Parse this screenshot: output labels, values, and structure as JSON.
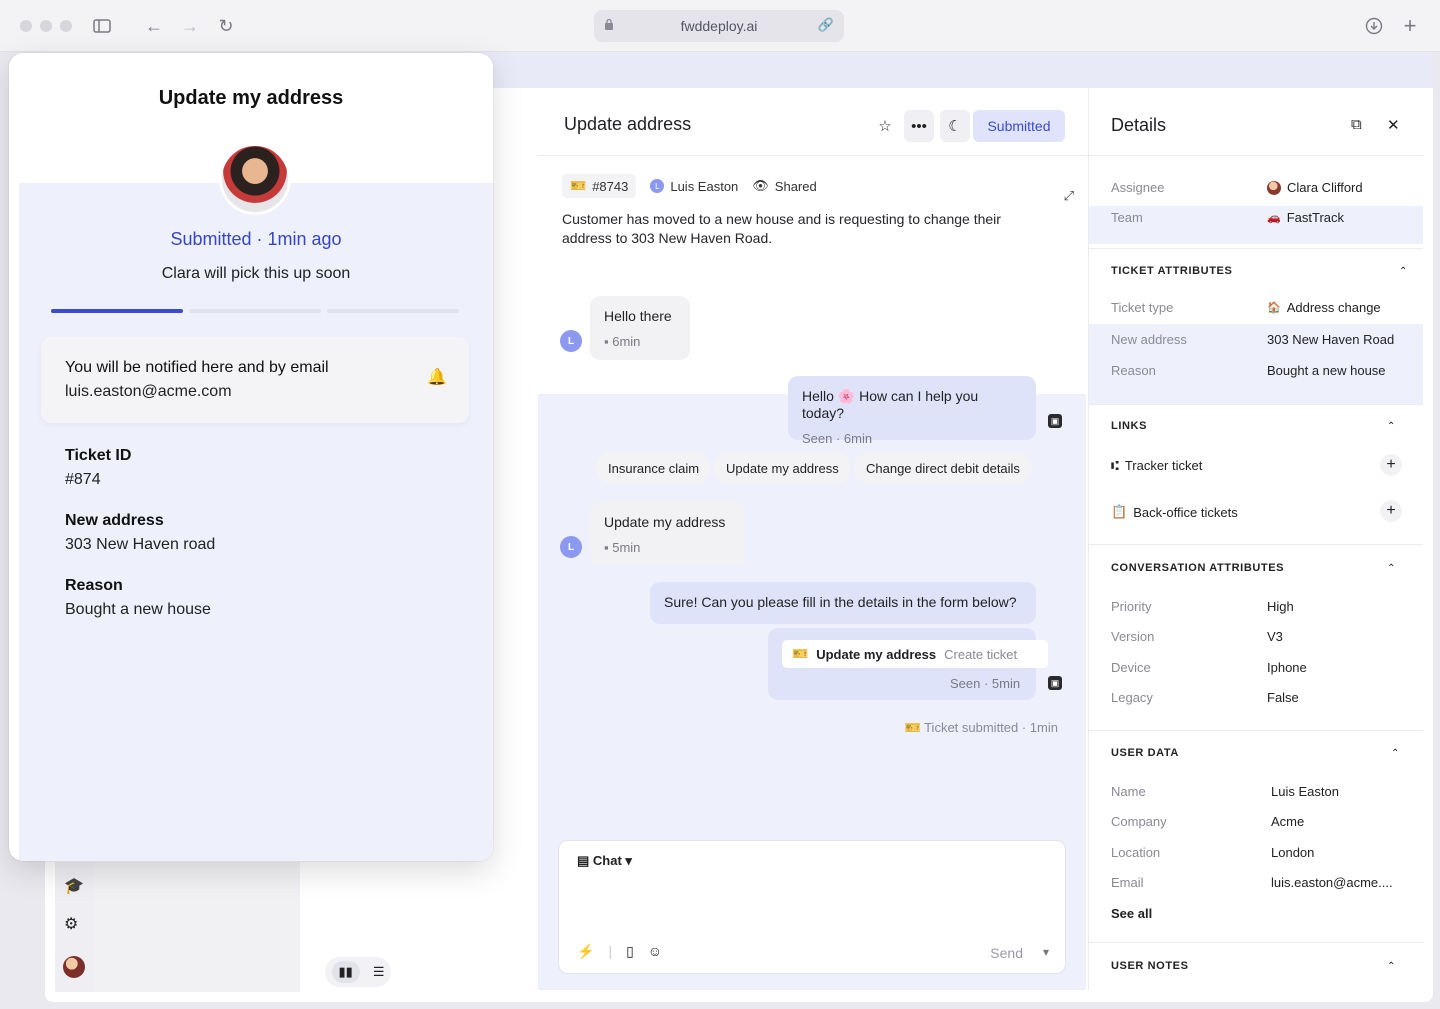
{
  "browser": {
    "url": "fwddeploy.ai"
  },
  "messenger": {
    "title": "Update my address",
    "status": "Submitted · 1min ago",
    "subtitle": "Clara will pick this up soon",
    "progress_steps": 3,
    "progress_completed": 1,
    "notify_title": "You will be notified here and by email",
    "notify_email": "luis.easton@acme.com",
    "fields": [
      {
        "label": "Ticket ID",
        "value": "#874"
      },
      {
        "label": "New address",
        "value": "303 New Haven road"
      },
      {
        "label": "Reason",
        "value": "Bought a new house"
      }
    ]
  },
  "conversation": {
    "title": "Update address",
    "submitted_label": "Submitted",
    "ticket_id": "#8743",
    "customer_name": "Luis Easton",
    "customer_initial": "L",
    "shared_label": "Shared",
    "description": "Customer has moved to a new house and is requesting to change their address to 303 New Haven Road.",
    "messages": [
      {
        "text": "Hello there",
        "meta": "6min"
      },
      {
        "text": "Hello 🌸 How can I help you today?",
        "meta": "Seen · 6min"
      },
      {
        "text": "Update my address",
        "meta": "5min"
      },
      {
        "text": "Sure! Can you please fill in the details in the form below?",
        "meta": ""
      }
    ],
    "quick_replies": [
      "Insurance claim",
      "Update my address",
      "Change direct debit details"
    ],
    "ticket_card": {
      "title": "Update my address",
      "action": "Create ticket",
      "meta": "Seen · 5min"
    },
    "ticket_submitted": "Ticket submitted · 1min",
    "composer": {
      "mode": "Chat",
      "send_label": "Send"
    }
  },
  "details": {
    "title": "Details",
    "assignee_label": "Assignee",
    "assignee": "Clara Clifford",
    "team_label": "Team",
    "team": "FastTrack",
    "ticket_attributes": {
      "title": "TICKET ATTRIBUTES",
      "rows": [
        {
          "key": "Ticket type",
          "value": "Address change"
        },
        {
          "key": "New address",
          "value": "303 New Haven Road"
        },
        {
          "key": "Reason",
          "value": "Bought a new house"
        }
      ]
    },
    "links": {
      "title": "LINKS",
      "items": [
        "Tracker ticket",
        "Back-office tickets"
      ]
    },
    "conversation_attributes": {
      "title": "CONVERSATION ATTRIBUTES",
      "rows": [
        {
          "key": "Priority",
          "value": "High"
        },
        {
          "key": "Version",
          "value": "V3"
        },
        {
          "key": "Device",
          "value": "Iphone"
        },
        {
          "key": "Legacy",
          "value": "False"
        }
      ]
    },
    "user_data": {
      "title": "USER DATA",
      "rows": [
        {
          "key": "Name",
          "value": "Luis Easton"
        },
        {
          "key": "Company",
          "value": "Acme"
        },
        {
          "key": "Location",
          "value": "London"
        },
        {
          "key": "Email",
          "value": "luis.easton@acme...."
        }
      ],
      "see_all": "See all"
    },
    "user_notes": {
      "title": "USER NOTES"
    }
  },
  "colors": {
    "accent": "#3545c9",
    "highlight_band": "#eef0fb",
    "progress_done": "#3a4bd1",
    "progress_todo": "#e2e2ea"
  }
}
